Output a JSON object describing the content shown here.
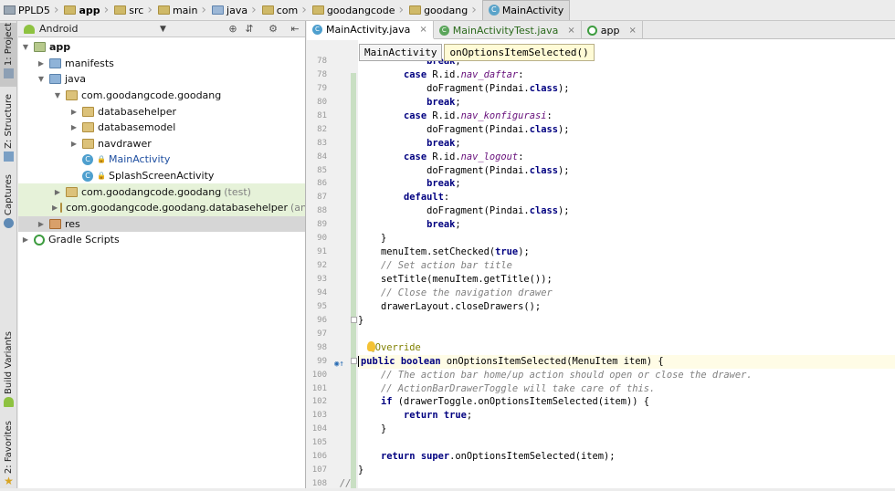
{
  "breadcrumbs": [
    "PPLD5",
    "app",
    "src",
    "main",
    "java",
    "com",
    "goodangcode",
    "goodang",
    "MainActivity"
  ],
  "sidebar_tabs": [
    "1: Project",
    "Z: Structure",
    "Captures",
    "Build Variants",
    "2: Favorites"
  ],
  "project_panel": {
    "view_selector": "Android",
    "tree": [
      {
        "label": "app"
      },
      {
        "label": "manifests"
      },
      {
        "label": "java"
      },
      {
        "label": "com.goodangcode.goodang"
      },
      {
        "label": "databasehelper"
      },
      {
        "label": "databasemodel"
      },
      {
        "label": "navdrawer"
      },
      {
        "label": "MainActivity"
      },
      {
        "label": "SplashScreenActivity"
      },
      {
        "label": "com.goodangcode.goodang",
        "suffix": "(test)"
      },
      {
        "label": "com.goodangcode.goodang.databasehelper",
        "suffix": "(androi"
      },
      {
        "label": "res"
      },
      {
        "label": "Gradle Scripts"
      }
    ]
  },
  "editor": {
    "tabs": [
      {
        "label": "MainActivity.java"
      },
      {
        "label": "MainActivityTest.java"
      },
      {
        "label": "app"
      }
    ],
    "structure_crumbs": [
      "MainActivity",
      "onOptionsItemSelected()"
    ],
    "line_numbers": [
      "78",
      "79",
      "80",
      "81",
      "82",
      "83",
      "84",
      "85",
      "86",
      "87",
      "88",
      "89",
      "90",
      "91",
      "92",
      "93",
      "94",
      "95",
      "96",
      "97",
      "98",
      "99",
      "100",
      "101",
      "102",
      "103",
      "104",
      "105",
      "106",
      "107",
      "108"
    ],
    "code": {
      "l78a": "case",
      "l78b": " R.id.",
      "l78c": "nav_daftar",
      "l78d": ":",
      "l79": "doFragment(Pindai.",
      "class": "class",
      "l79e": ");",
      "break": "break",
      "semi": ";",
      "l81c": "nav_konfigurasi",
      "l84c": "nav_logout",
      "default": "default",
      "colon": ":",
      "close": "}",
      "l91a": "menuItem.setChecked(",
      "true": "true",
      "l91b": ");",
      "l92": "// Set action bar title",
      "l93": "setTitle(menuItem.getTitle());",
      "l94": "// Close the navigation drawer",
      "l95": "drawerLayout.closeDrawers();",
      "l98": "@Override",
      "public": "public",
      "boolean": "boolean",
      "l99": " onOptionsItemSelected(MenuItem item) {",
      "l100": "// The action bar home/up action should open or close the drawer.",
      "l101": "// ActionBarDrawerToggle will take care of this.",
      "if": "if",
      "l102": " (drawerToggle.onOptionsItemSelected(item)) {",
      "return": "return",
      "super": "super",
      "l106": ".onOptionsItemSelected(item);",
      "l108": "//"
    }
  }
}
